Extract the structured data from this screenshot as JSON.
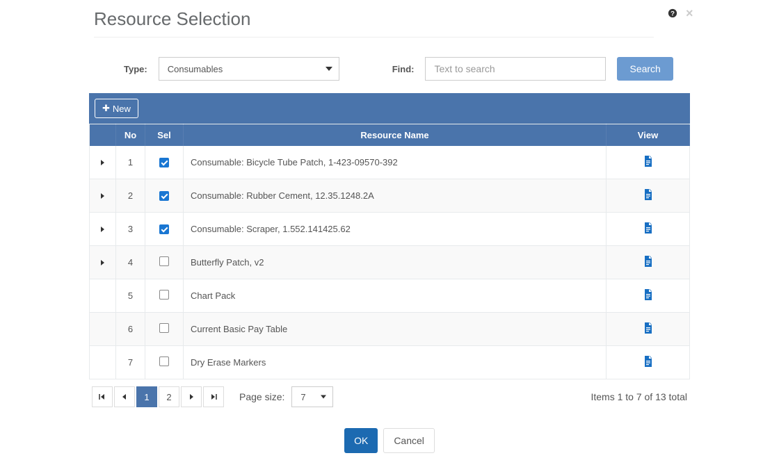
{
  "header": {
    "title": "Resource Selection"
  },
  "filters": {
    "type_label": "Type:",
    "type_value": "Consumables",
    "find_label": "Find:",
    "find_placeholder": "Text to search",
    "search_button": "Search"
  },
  "toolbar": {
    "new_button": "New"
  },
  "columns": {
    "expand": "",
    "no": "No",
    "sel": "Sel",
    "name": "Resource Name",
    "view": "View"
  },
  "rows": [
    {
      "expandable": true,
      "no": "1",
      "selected": true,
      "name": "Consumable: Bicycle Tube Patch, 1-423-09570-392"
    },
    {
      "expandable": true,
      "no": "2",
      "selected": true,
      "name": "Consumable: Rubber Cement, 12.35.1248.2A"
    },
    {
      "expandable": true,
      "no": "3",
      "selected": true,
      "name": "Consumable: Scraper, 1.552.141425.62"
    },
    {
      "expandable": true,
      "no": "4",
      "selected": false,
      "name": "Butterfly Patch, v2"
    },
    {
      "expandable": false,
      "no": "5",
      "selected": false,
      "name": "Chart Pack"
    },
    {
      "expandable": false,
      "no": "6",
      "selected": false,
      "name": "Current Basic Pay Table"
    },
    {
      "expandable": false,
      "no": "7",
      "selected": false,
      "name": "Dry Erase Markers"
    }
  ],
  "pager": {
    "pages": [
      "1",
      "2"
    ],
    "active_page": "1",
    "page_size_label": "Page size:",
    "page_size_value": "7",
    "summary": "Items 1 to 7 of 13 total"
  },
  "footer": {
    "ok": "OK",
    "cancel": "Cancel"
  }
}
